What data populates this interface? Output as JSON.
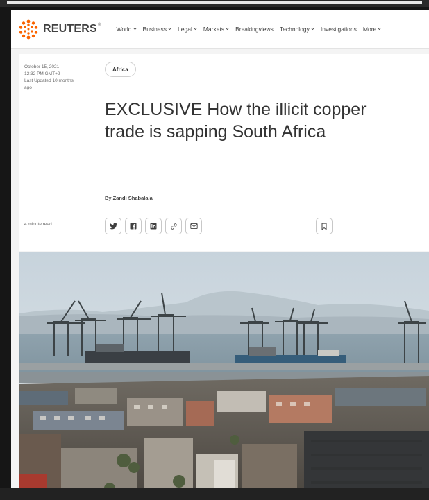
{
  "brand": {
    "name": "REUTERS",
    "reg_mark": "®",
    "accent": "#fa6400"
  },
  "nav": {
    "items": [
      {
        "label": "World",
        "has_menu": true
      },
      {
        "label": "Business",
        "has_menu": true
      },
      {
        "label": "Legal",
        "has_menu": true
      },
      {
        "label": "Markets",
        "has_menu": true
      },
      {
        "label": "Breakingviews",
        "has_menu": false
      },
      {
        "label": "Technology",
        "has_menu": true
      },
      {
        "label": "Investigations",
        "has_menu": false
      },
      {
        "label": "More",
        "has_menu": true
      }
    ]
  },
  "article": {
    "date": "October 15, 2021",
    "time": "12:32 PM GMT+2",
    "last_updated_line1": "Last Updated 10 months",
    "last_updated_line2": "ago",
    "tag": "Africa",
    "headline": "EXCLUSIVE How the illicit copper trade is sapping South Africa",
    "byline": "By Zandi Shabalala",
    "read_time": "4 minute read"
  },
  "share": {
    "buttons": [
      "twitter-icon",
      "facebook-icon",
      "linkedin-icon",
      "link-icon",
      "email-icon"
    ],
    "bookmark": "bookmark-icon"
  },
  "hero_image": {
    "subject": "harbour-with-cranes-and-cargo-ships"
  },
  "colors": {
    "text_primary": "#333333",
    "text_meta": "#6b6b6b",
    "border": "#c8c8c8",
    "background": "#f4f4f4"
  }
}
